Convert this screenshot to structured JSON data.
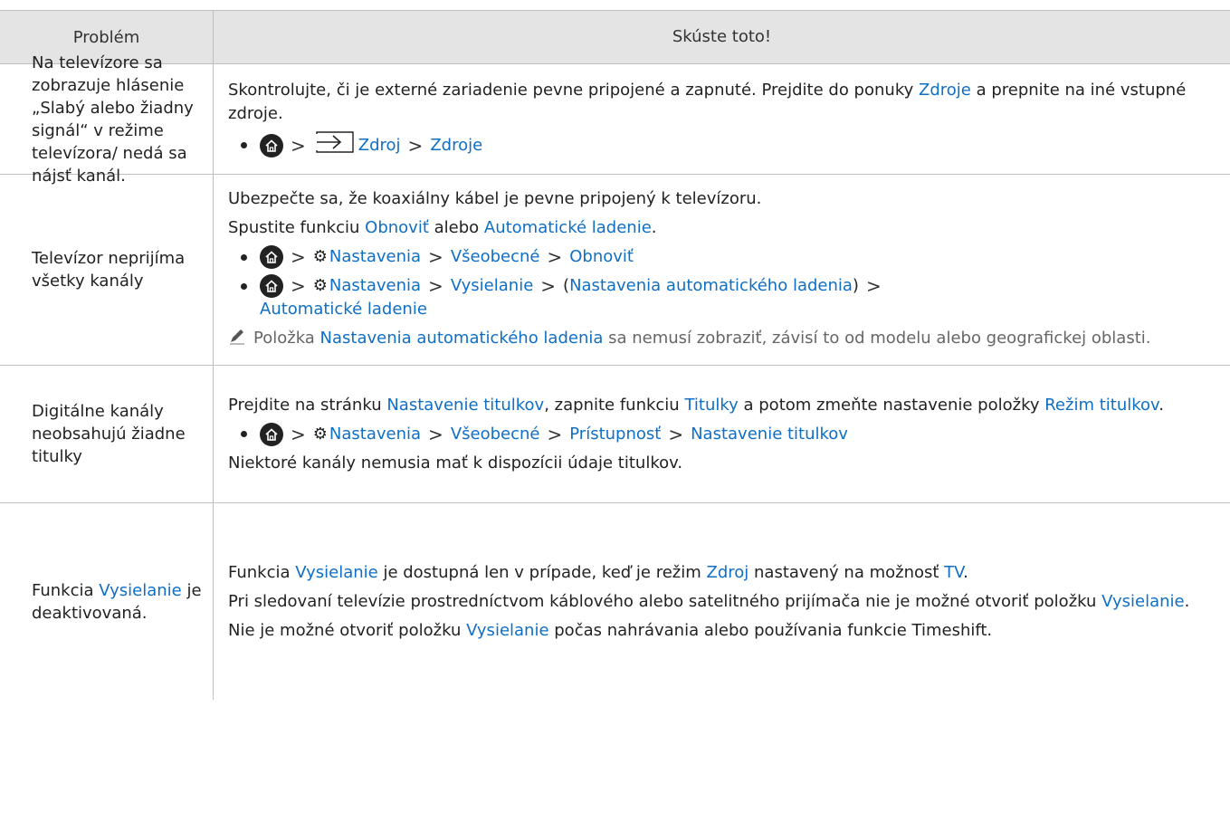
{
  "header": {
    "problem": "Problém",
    "solution": "Skúste toto!"
  },
  "rows": [
    {
      "problem": "Na televízore sa zobrazuje hlásenie „Slabý alebo žiadny signál“ v režime televízora/ nedá sa nájsť kanál.",
      "text1a": "Skontrolujte, či je externé zariadenie pevne pripojené a zapnuté. Prejdite do ponuky ",
      "text1b": "Zdroje",
      "text1c": " a prepnite na iné vstupné zdroje.",
      "path": [
        "Zdroj",
        "Zdroje"
      ]
    },
    {
      "problem": "Televízor neprijíma všetky kanály",
      "text1": "Ubezpečte sa, že koaxiálny kábel je pevne pripojený k televízoru.",
      "text2a": "Spustite funkciu ",
      "text2b": "Obnoviť",
      "text2c": " alebo ",
      "text2d": "Automatické ladenie",
      "text2e": ".",
      "path1": [
        "Nastavenia",
        "Všeobecné",
        "Obnoviť"
      ],
      "path2": [
        "Nastavenia",
        "Vysielanie",
        "Nastavenia automatického ladenia",
        "Automatické ladenie"
      ],
      "path2_open": "(",
      "path2_close": ")",
      "note_a": "Položka ",
      "note_b": "Nastavenia automatického ladenia",
      "note_c": " sa nemusí zobraziť, závisí to od modelu alebo geografickej oblasti."
    },
    {
      "problem": "Digitálne kanály neobsahujú žiadne titulky",
      "text1a": "Prejdite na stránku ",
      "text1b": "Nastavenie titulkov",
      "text1c": ", zapnite funkciu ",
      "text1d": "Titulky",
      "text1e": " a potom zmeňte nastavenie položky ",
      "text1f": "Režim titulkov",
      "text1g": ".",
      "path": [
        "Nastavenia",
        "Všeobecné",
        "Prístupnosť",
        "Nastavenie titulkov"
      ],
      "text2": "Niektoré kanály nemusia mať k dispozícii údaje titulkov."
    },
    {
      "problem_a": "Funkcia ",
      "problem_b": "Vysielanie",
      "problem_c": " je deaktivovaná.",
      "text1a": "Funkcia ",
      "text1b": "Vysielanie",
      "text1c": " je dostupná len v prípade, keď je režim ",
      "text1d": "Zdroj",
      "text1e": " nastavený na možnosť ",
      "text1f": "TV",
      "text1g": ".",
      "text2a": "Pri sledovaní televízie prostredníctvom káblového alebo satelitného prijímača nie je možné otvoriť položku ",
      "text2b": "Vysielanie",
      "text2c": ".",
      "text3a": "Nie je možné otvoriť položku ",
      "text3b": "Vysielanie",
      "text3c": " počas nahrávania alebo používania funkcie Timeshift."
    }
  ],
  "colors": {
    "highlight": "#0f6fc6",
    "header_bg": "#e4e4e4"
  },
  "icons": [
    "home-icon",
    "source-icon",
    "gear-icon",
    "chevron-right-icon",
    "pencil-note-icon"
  ]
}
